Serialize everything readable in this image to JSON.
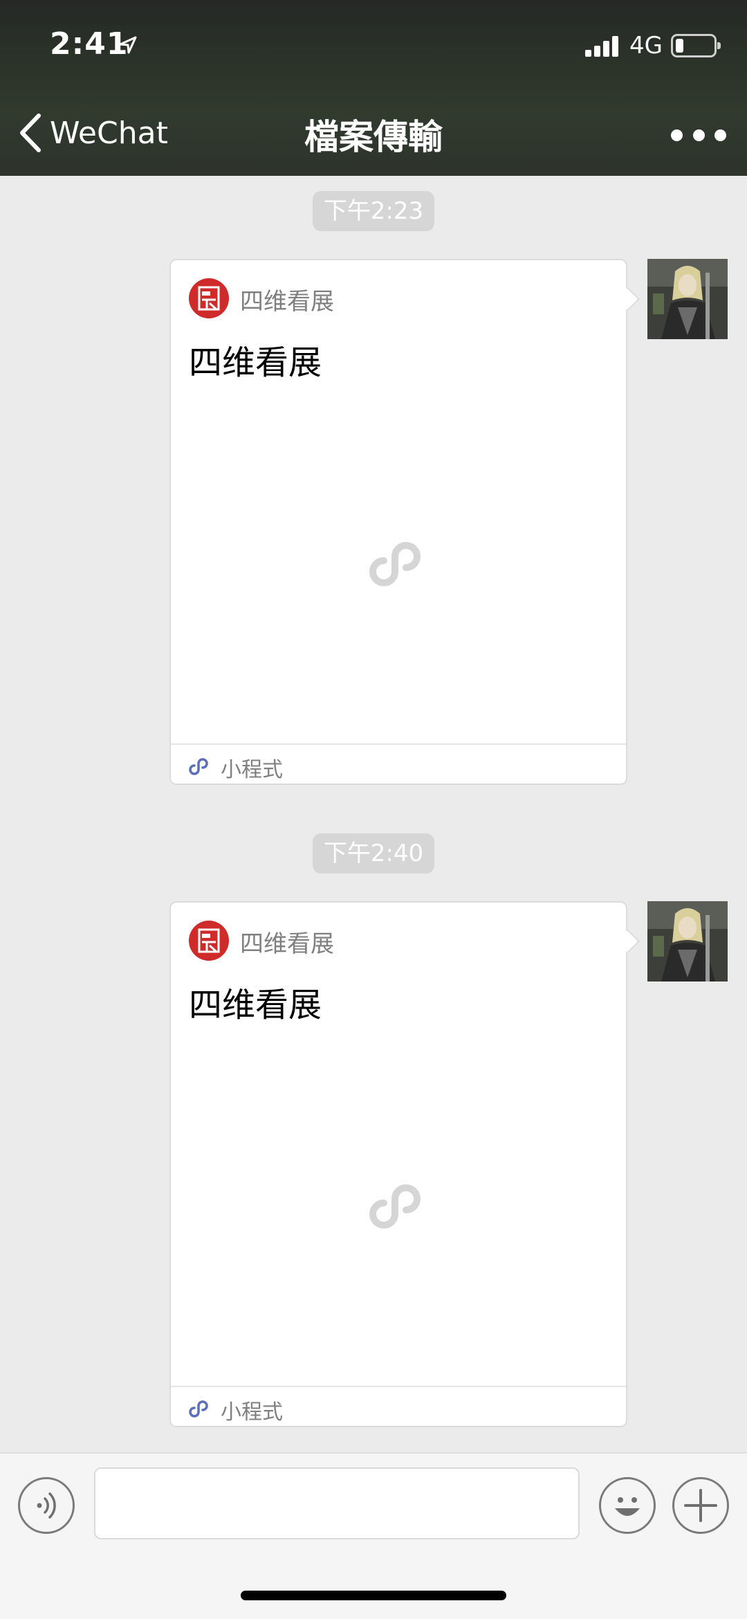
{
  "status_bar": {
    "time": "2:41",
    "network": "4G",
    "battery_level": 0.2
  },
  "nav": {
    "back_label": "WeChat",
    "title": "檔案傳輸",
    "more_icon": "ellipsis-icon"
  },
  "messages": [
    {
      "timestamp": "下午2:23",
      "card": {
        "app_name": "四维看展",
        "title": "四维看展",
        "footer_label": "小程式",
        "logo_color": "#cf2b2b"
      }
    },
    {
      "timestamp": "下午2:40",
      "card": {
        "app_name": "四维看展",
        "title": "四维看展",
        "footer_label": "小程式",
        "logo_color": "#cf2b2b"
      }
    }
  ],
  "input_bar": {
    "value": "",
    "icons": [
      "voice-icon",
      "emoji-icon",
      "plus-icon"
    ]
  },
  "colors": {
    "chat_background": "#ebebeb",
    "timestamp_background": "#d6d6d6",
    "mini_program_link": "#5b6fb8"
  }
}
